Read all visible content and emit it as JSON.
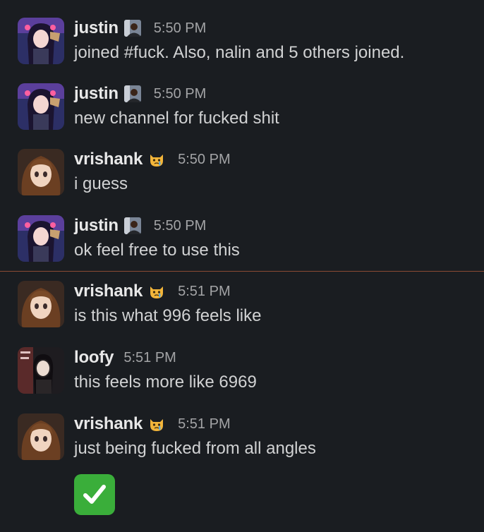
{
  "colors": {
    "background": "#1a1d21",
    "username": "#e8e8e8",
    "message_text": "#d1d2d3",
    "timestamp": "#a3a4a6",
    "new_messages_divider": "#8a4a34",
    "check_reaction": "#3aae3a"
  },
  "messages": [
    {
      "user": "justin",
      "badge_icon": "person-photo-icon",
      "time": "5:50 PM",
      "text": "joined #fuck. Also, nalin and 5 others joined."
    },
    {
      "user": "justin",
      "badge_icon": "person-photo-icon",
      "time": "5:50 PM",
      "text": "new channel for fucked shit"
    },
    {
      "user": "vrishank",
      "badge_icon": "crying-cat-emoji-icon",
      "time": "5:50 PM",
      "text": "i guess"
    },
    {
      "user": "justin",
      "badge_icon": "person-photo-icon",
      "time": "5:50 PM",
      "text": "ok feel free to use this"
    },
    {
      "user": "vrishank",
      "badge_icon": "crying-cat-emoji-icon",
      "time": "5:51 PM",
      "text": "is this what 996 feels like"
    },
    {
      "user": "loofy",
      "time": "5:51 PM",
      "text": "this feels more like 6969"
    },
    {
      "user": "vrishank",
      "badge_icon": "crying-cat-emoji-icon",
      "time": "5:51 PM",
      "text": "just being fucked from all angles"
    }
  ],
  "reaction": {
    "icon": "white-check-mark-icon"
  }
}
